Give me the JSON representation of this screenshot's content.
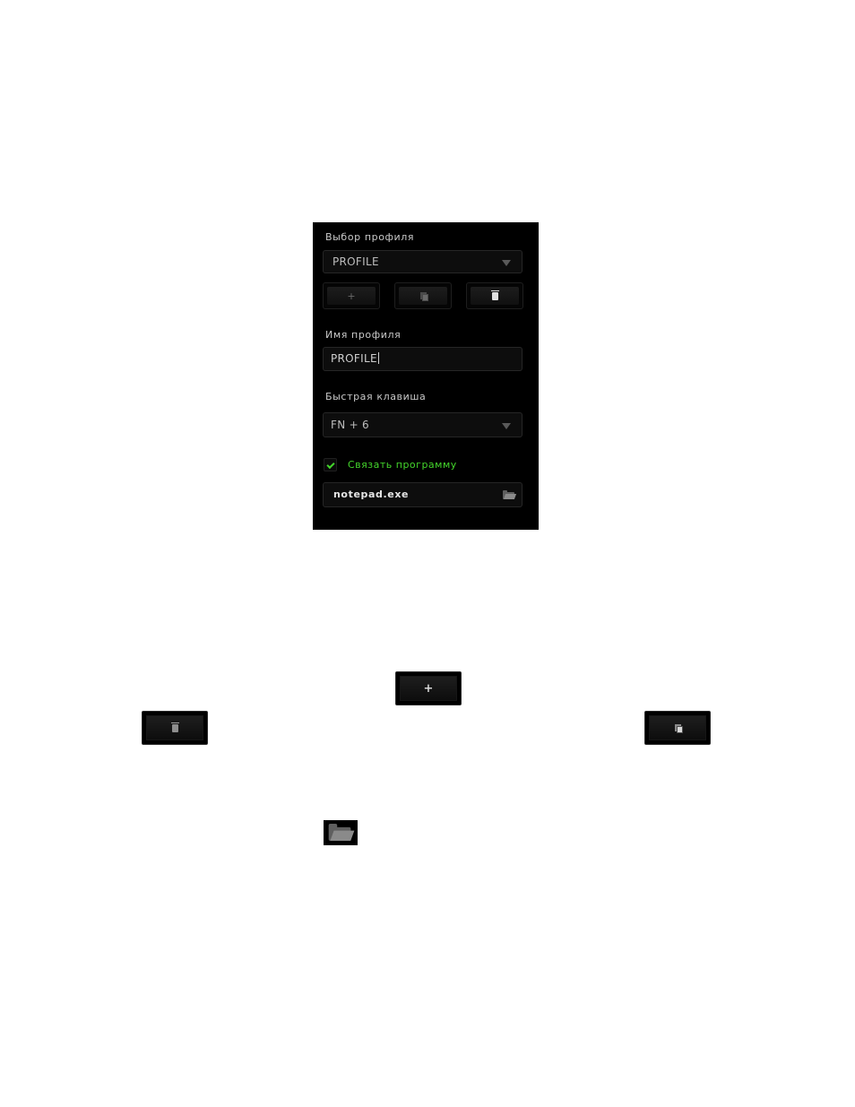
{
  "profile_panel": {
    "select_label": "Выбор профиля",
    "selected_profile": "PROFILE",
    "name_label": "Имя профиля",
    "name_value": "PROFILE",
    "hotkey_label": "Быстрая клавиша",
    "hotkey_value": "FN + 6",
    "link_program_label": "Связать программу",
    "link_program_checked": true,
    "program_path": "notepad.exe",
    "buttons": {
      "add": "+",
      "copy_icon": "copy-icon",
      "delete_icon": "trash-icon"
    }
  },
  "legend": {
    "add_button": "+",
    "delete_button_icon": "trash-icon",
    "copy_button_icon": "copy-icon",
    "folder_button_icon": "folder-icon"
  },
  "colors": {
    "accent": "#44d62c",
    "panel_bg": "#000000"
  }
}
